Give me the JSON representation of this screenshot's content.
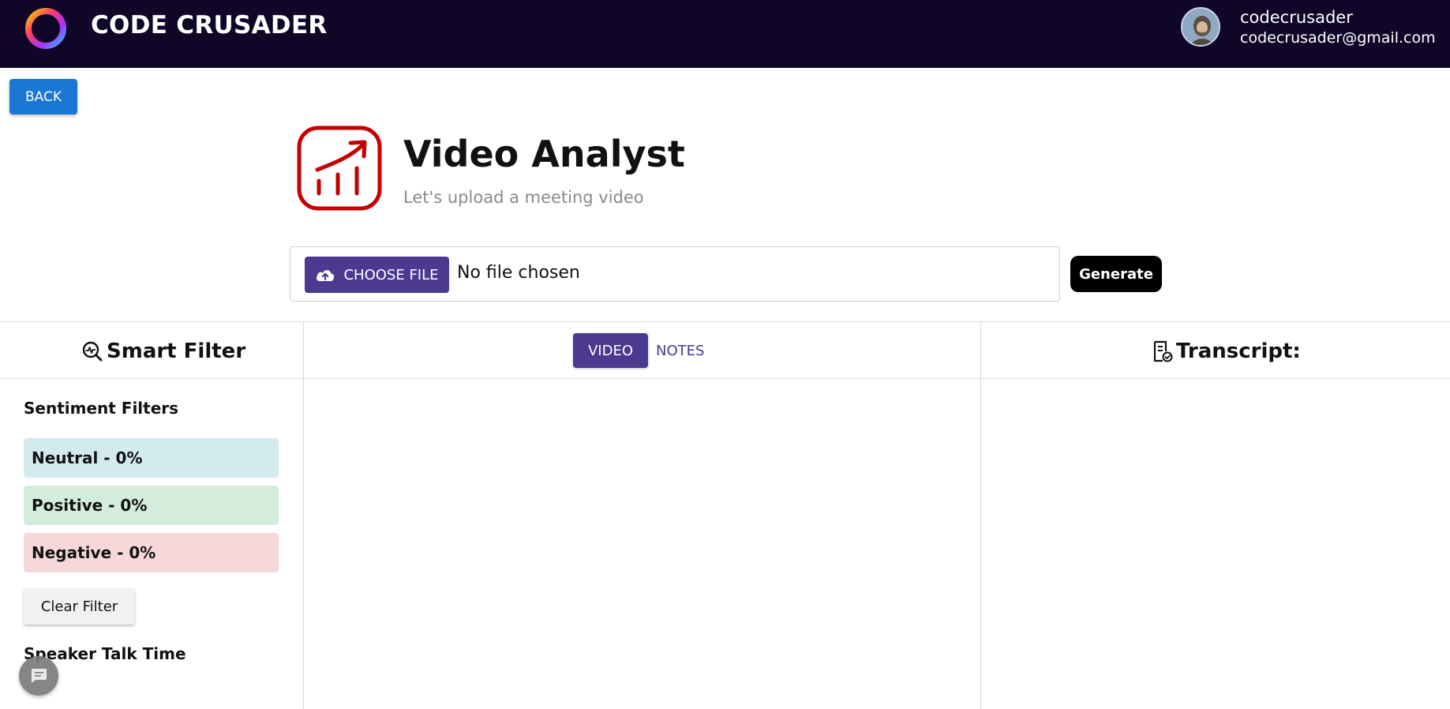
{
  "header": {
    "brand": "CODE CRUSADER",
    "user_name": "codecrusader",
    "user_email": "codecrusader@gmail.com",
    "logo_icon": "ring-logo-icon",
    "avatar_icon": "user-avatar"
  },
  "nav": {
    "back_label": "BACK"
  },
  "hero": {
    "title": "Video Analyst",
    "subtitle": "Let's upload a meeting video",
    "icon": "trending-up-chart-icon",
    "accent": "#c40000"
  },
  "upload": {
    "choose_label": "CHOOSE FILE",
    "file_status": "No file chosen",
    "generate_label": "Generate"
  },
  "columns": {
    "smart_filter": "Smart Filter",
    "transcript": "Transcript:",
    "tabs": [
      {
        "label": "VIDEO",
        "active": true
      },
      {
        "label": "NOTES",
        "active": false
      }
    ]
  },
  "sidebar": {
    "sentiment_title": "Sentiment Filters",
    "filters": [
      {
        "label": "Neutral - 0%",
        "color": "#d3ebef"
      },
      {
        "label": "Positive - 0%",
        "color": "#d4ecdc"
      },
      {
        "label": "Negative - 0%",
        "color": "#f6d7da"
      }
    ],
    "clear_label": "Clear Filter",
    "speaker_title": "Speaker Talk Time"
  },
  "colors": {
    "header_bg": "#0f0628",
    "primary": "#4b3a8f",
    "back_button": "#1976d2"
  }
}
